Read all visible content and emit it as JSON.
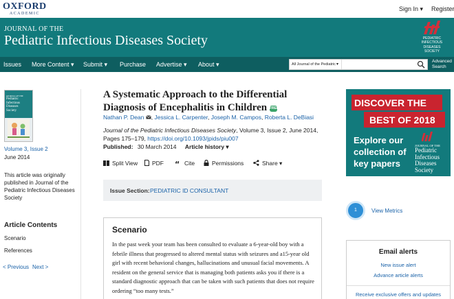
{
  "header": {
    "logo_line1": "OXFORD",
    "logo_line2": "ACADEMIC",
    "sign_in": "Sign In",
    "sign_in_caret": "▾",
    "register": "Register"
  },
  "banner": {
    "journal_of": "JOURNAL OF THE",
    "journal_name": "Pediatric Infectious Diseases Society",
    "society_logo_text": [
      "PEDIATRIC INFECTIOUS",
      "DISEASES SOCIETY"
    ]
  },
  "nav": {
    "items": [
      "Issues",
      "More Content ▾",
      "Submit ▾",
      "Purchase",
      "Advertise ▾",
      "About ▾"
    ],
    "search_scope": "All Journal of the Pediatric",
    "search_scope_caret": "▾",
    "search_value": "",
    "advanced_search": [
      "Advanced",
      "Search"
    ]
  },
  "sidebar": {
    "cover_title": [
      "JOURNAL OF THE",
      "Pediatric",
      "Infectious",
      "Diseases",
      "Society"
    ],
    "issue_link": "Volume 3, Issue 2",
    "issue_date": "June 2014",
    "note": [
      "This article was originally",
      "published in Journal of the",
      "Pediatric Infectious Diseases",
      "Society"
    ],
    "contents_heading": "Article Contents",
    "contents": [
      "Scenario",
      "References"
    ],
    "prev": "< Previous",
    "next": "Next >"
  },
  "article": {
    "title": "A Systematic Approach to the Differential Diagnosis of Encephalitis in Children",
    "free_badge": "FREE",
    "authors": [
      "Nathan P. Dean",
      "Jessica L. Carpenter",
      "Joseph M. Campos",
      "Roberta L. DeBiasi"
    ],
    "author_separator": ",",
    "citation_journal": "Journal of the Pediatric Infectious Diseases Society",
    "citation_rest": ", Volume 3, Issue 2, June 2014, Pages 175–179,",
    "doi": "https://doi.org/10.1093/jpids/piu007",
    "published_label": "Published:",
    "published_date": "30 March 2014",
    "history": "Article history ▾",
    "tools": [
      "Split View",
      "PDF",
      "Cite",
      "Permissions",
      "Share ▾"
    ],
    "issue_section_label": "Issue Section:",
    "issue_section_value": "PEDIATRIC ID CONSULTANT",
    "scenario_heading": "Scenario",
    "scenario_text": "In the past week your team has been consulted to evaluate a 6-year-old boy with a febrile illness that progressed to altered mental status with seizures and a15-year old girl with recent behavioral changes, hallucinations and unusual facial movements. A resident on the general service that is managing both patients asks you if there is a standard diagnostic approach that can be taken with such patients that does not require ordering “too many tests.”"
  },
  "ad": {
    "line1": "DISCOVER THE",
    "line2": "BEST OF 2018",
    "body": [
      "Explore our",
      "collection of",
      "key papers"
    ],
    "journal": [
      "JOURNAL OF THE",
      "Pediatric",
      "Infectious",
      "Diseases",
      "Society"
    ]
  },
  "metrics": {
    "count": "1",
    "label": "View Metrics"
  },
  "alerts": {
    "heading": "Email alerts",
    "links": [
      "New issue alert",
      "Advance article alerts",
      "Receive exclusive offers and updates"
    ]
  },
  "colors": {
    "teal": "#127a7c",
    "nav": "#0e5e60",
    "link": "#1a62a8",
    "red": "#c9242f"
  }
}
